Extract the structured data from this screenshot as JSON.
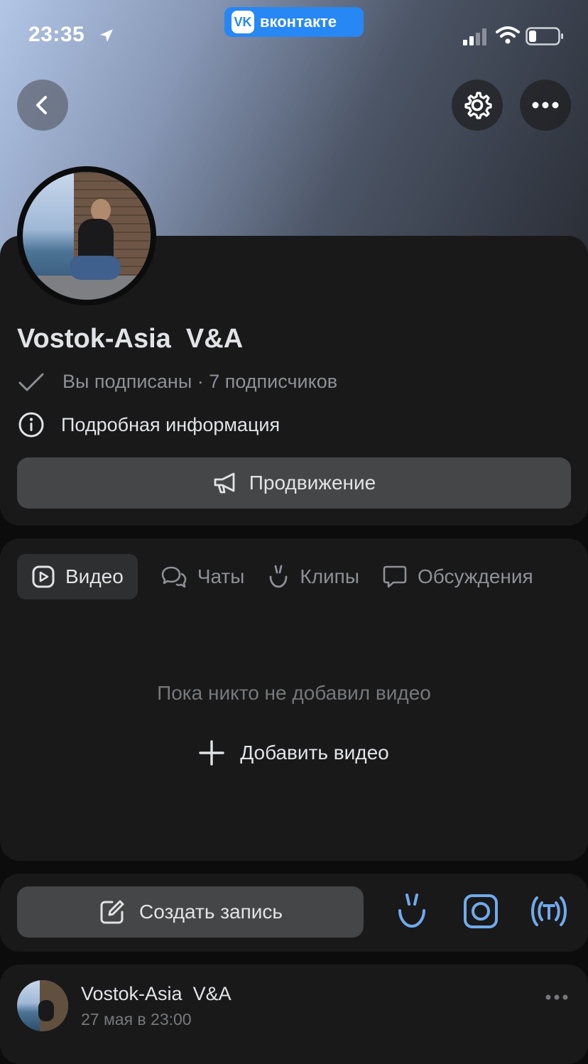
{
  "status_bar": {
    "time": "23:35",
    "app_pill": "вконтакте"
  },
  "profile": {
    "name": "Vostok-Asia  V&A",
    "subscription": "Вы подписаны · 7 подписчиков",
    "details": "Подробная информация",
    "promo_button": "Продвижение"
  },
  "tabs": [
    {
      "label": "Видео",
      "icon": "video-play-icon",
      "active": true
    },
    {
      "label": "Чаты",
      "icon": "chats-icon"
    },
    {
      "label": "Клипы",
      "icon": "clips-icon"
    },
    {
      "label": "Обсуждения",
      "icon": "discussion-icon"
    }
  ],
  "videos_section": {
    "empty_message": "Пока никто не добавил видео",
    "add_label": "Добавить видео"
  },
  "composer": {
    "create_label": "Создать запись",
    "icons": [
      "clips-icon",
      "camera-icon",
      "live-stream-icon"
    ]
  },
  "post": {
    "author": "Vostok-Asia  V&A",
    "date": "27 мая в 23:00"
  },
  "colors": {
    "accent": "#2787f5",
    "icon_accent": "#71aaeb",
    "card_bg": "#19191a",
    "button_bg": "#454647"
  }
}
